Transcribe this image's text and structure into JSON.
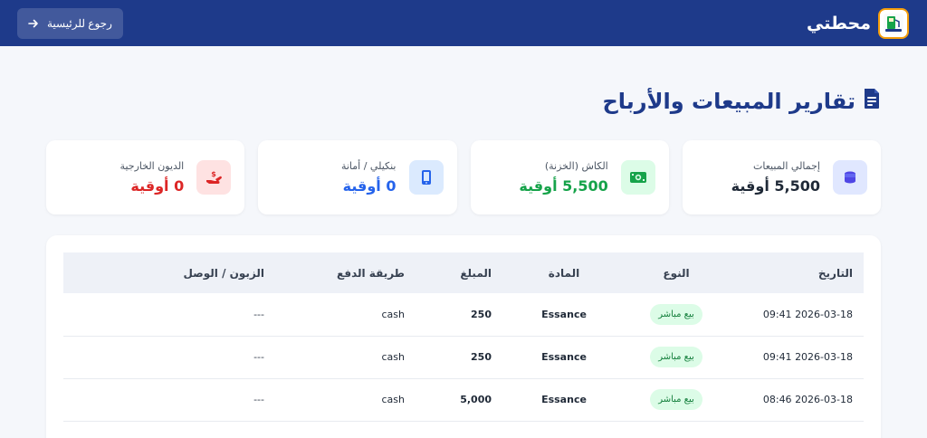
{
  "header": {
    "brand_name": "محطتي",
    "back_label": "رجوع للرئيسية",
    "logo_icon": "fuel-station-icon"
  },
  "page": {
    "title": "تقارير المبيعات والأرباح",
    "title_icon": "document-icon"
  },
  "cards": [
    {
      "label": "إجمالي المبيعات",
      "value": "5,500 أوقية",
      "icon": "coins-icon",
      "color": "#1f2937",
      "icon_bg": "#e0e7ff",
      "icon_color": "#4f46e5"
    },
    {
      "label": "الكاش (الخزنة)",
      "value": "5,500 أوقية",
      "icon": "cash-icon",
      "color": "#16a34a",
      "icon_bg": "#dcfce7",
      "icon_color": "#16a34a"
    },
    {
      "label": "بنكيلي / أمانة",
      "value": "0 أوقية",
      "icon": "mobile-icon",
      "color": "#2563eb",
      "icon_bg": "#dbeafe",
      "icon_color": "#2563eb"
    },
    {
      "label": "الديون الخارجية",
      "value": "0 أوقية",
      "icon": "hand-money-icon",
      "color": "#dc2626",
      "icon_bg": "#fee2e2",
      "icon_color": "#dc2626"
    }
  ],
  "table": {
    "headers": {
      "date": "التاريخ",
      "type": "النوع",
      "item": "المادة",
      "amount": "المبلغ",
      "payment": "طريقة الدفع",
      "customer": "الزبون / الوصل"
    },
    "rows": [
      {
        "date": "2026-03-18 09:41",
        "type": "بيع مباشر",
        "item": "Essance",
        "amount": "250",
        "payment": "cash",
        "customer": "---"
      },
      {
        "date": "2026-03-18 09:41",
        "type": "بيع مباشر",
        "item": "Essance",
        "amount": "250",
        "payment": "cash",
        "customer": "---"
      },
      {
        "date": "2026-03-18 08:46",
        "type": "بيع مباشر",
        "item": "Essance",
        "amount": "5,000",
        "payment": "cash",
        "customer": "---"
      }
    ]
  }
}
